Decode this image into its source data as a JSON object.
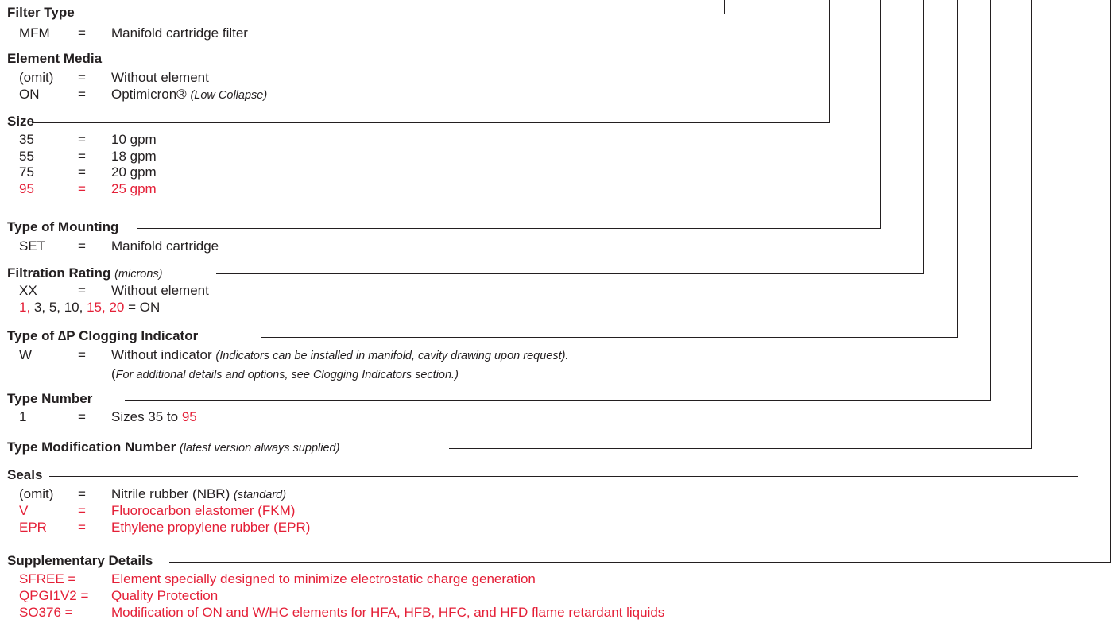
{
  "colors": {
    "text": "#231f20",
    "accent_red": "#e41f37"
  },
  "sections": [
    {
      "title": "Filter Type",
      "rows": [
        {
          "code": "MFM",
          "desc": "Manifold cartridge filter"
        }
      ]
    },
    {
      "title": "Element Media",
      "rows": [
        {
          "code": "(omit)",
          "desc": "Without element"
        },
        {
          "code": "ON",
          "desc": "Optimicron®",
          "note": "(Low Collapse)"
        }
      ]
    },
    {
      "title": "Size",
      "rows": [
        {
          "code": "35",
          "desc": "10 gpm"
        },
        {
          "code": "55",
          "desc": "18 gpm"
        },
        {
          "code": "75",
          "desc": "20 gpm"
        },
        {
          "code": "95",
          "desc": "25 gpm",
          "highlight": true
        }
      ]
    },
    {
      "title": "Type of Mounting",
      "rows": [
        {
          "code": "SET",
          "desc": "Manifold cartridge"
        }
      ]
    },
    {
      "title": "Filtration Rating",
      "title_note": "(microns)",
      "rows": [
        {
          "code": "XX",
          "desc": "Without element"
        }
      ],
      "ratings": {
        "r1": "1,",
        "r2": "3, 5, 10,",
        "r3": "15, 20",
        "suffix": "= ON"
      }
    },
    {
      "title": "Type of ∆P Clogging Indicator",
      "rows": [
        {
          "code": "W",
          "desc": "Without indicator",
          "note": "(Indicators can be installed in manifold, cavity drawing upon request).",
          "line2_open": "(",
          "line2_note": "For additional details and options, see Clogging Indicators section.)"
        }
      ]
    },
    {
      "title": "Type Number",
      "rows": [
        {
          "code": "1",
          "desc": "Sizes 35 to",
          "desc_red": "95"
        }
      ]
    },
    {
      "title": "Type Modification Number",
      "title_note": "(latest version always supplied)",
      "rows": []
    },
    {
      "title": "Seals",
      "rows": [
        {
          "code": "(omit)",
          "desc": "Nitrile rubber (NBR)",
          "note": "(standard)"
        },
        {
          "code": "V",
          "desc": "Fluorocarbon elastomer (FKM)",
          "highlight": true
        },
        {
          "code": "EPR",
          "desc": "Ethylene propylene rubber (EPR)",
          "highlight": true
        }
      ]
    },
    {
      "title": "Supplementary Details",
      "rows": [
        {
          "code": "SFREE =",
          "desc": "Element specially designed to minimize electrostatic charge generation",
          "highlight": true
        },
        {
          "code": "QPGI1V2 =",
          "desc": "Quality Protection",
          "highlight": true
        },
        {
          "code": "SO376 =",
          "desc": "Modification of ON and W/HC elements for HFA, HFB, HFC, and HFD flame retardant liquids",
          "highlight": true
        }
      ]
    }
  ],
  "eq": "="
}
